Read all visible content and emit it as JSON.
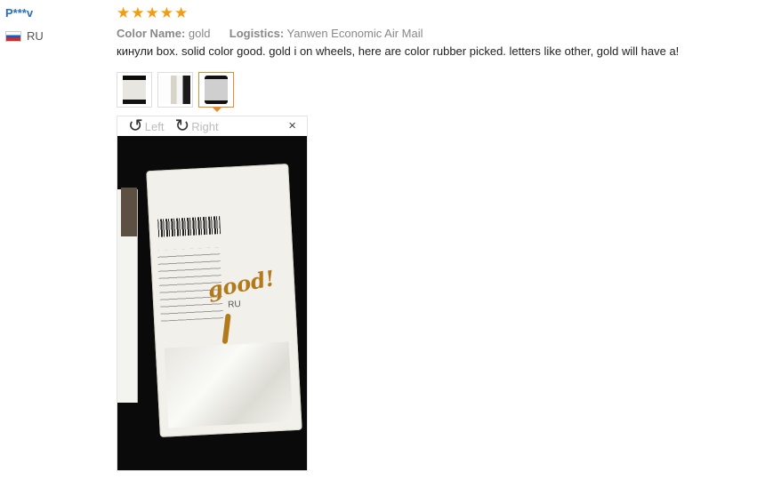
{
  "user": {
    "name": "P***v",
    "country_code": "RU"
  },
  "review": {
    "rating": 5,
    "stars": [
      "★",
      "★",
      "★",
      "★",
      "★"
    ],
    "color_label": "Color Name:",
    "color_value": "gold",
    "logistics_label": "Logistics:",
    "logistics_value": "Yanwen Economic Air Mail",
    "text": "кинули box. solid color good. gold i on wheels, here are color rubber picked. letters like other, gold will have a!"
  },
  "thumbnails": {
    "count": 3,
    "selected_index": 3
  },
  "viewer": {
    "rotate_left_label": "Left",
    "rotate_right_label": "Right",
    "close_symbol": "×",
    "rotate_left_icon": "↺",
    "rotate_right_icon": "↻"
  },
  "photo": {
    "handwritten_text": "good!",
    "label_country": "RU"
  },
  "colors": {
    "username": "#2a6fb3",
    "stars": "#f39c12",
    "active_thumb_border": "#e68a2e"
  }
}
